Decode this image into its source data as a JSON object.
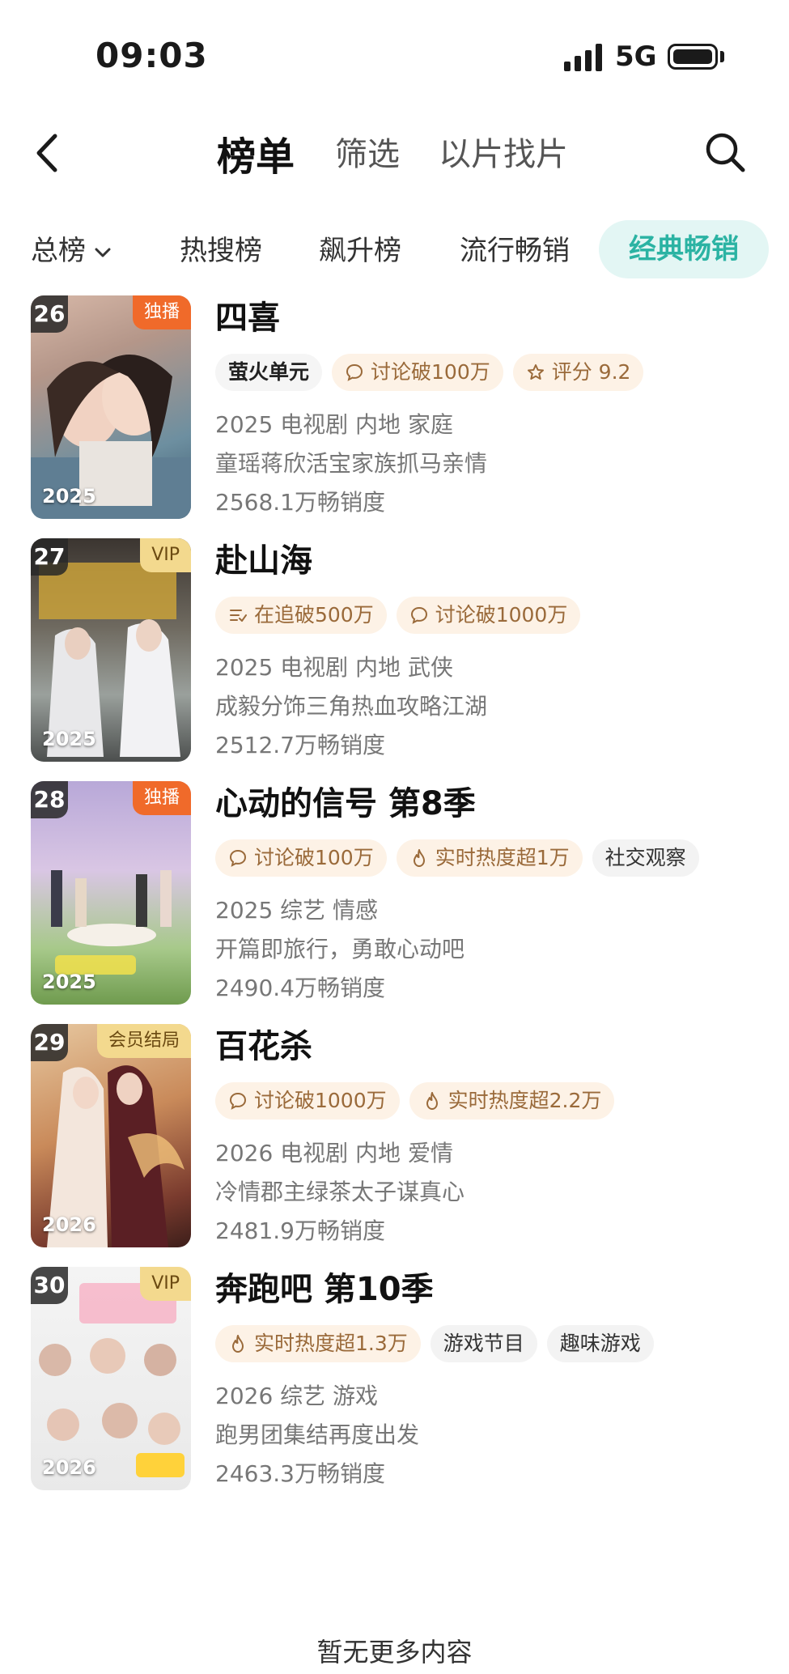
{
  "status_bar": {
    "time": "09:03",
    "network": "5G"
  },
  "header": {
    "tabs": [
      {
        "label": "榜单",
        "active": true
      },
      {
        "label": "筛选",
        "active": false
      },
      {
        "label": "以片找片",
        "active": false
      }
    ]
  },
  "filters": {
    "dropdown_label": "总榜",
    "items": [
      "热搜榜",
      "飙升榜",
      "流行畅销"
    ],
    "active": "经典畅销",
    "active_color": "#2bb3a3"
  },
  "list": [
    {
      "rank": "26",
      "badge": "独播",
      "badge_type": "exclusive",
      "poster_year": "2025",
      "title": "四喜",
      "tags": [
        {
          "icon": "brand-logo",
          "text": "萤火单元",
          "style": "brand"
        },
        {
          "icon": "comment-icon",
          "text": "讨论破100万",
          "style": "warm"
        },
        {
          "icon": "star-icon",
          "text": "评分 9.2",
          "style": "warm"
        }
      ],
      "meta": "2025 电视剧 内地 家庭",
      "desc": "童瑶蒋欣活宝家族抓马亲情",
      "sales": "2568.1万畅销度"
    },
    {
      "rank": "27",
      "badge": "VIP",
      "badge_type": "vip",
      "poster_year": "2025",
      "title": "赴山海",
      "tags": [
        {
          "icon": "list-icon",
          "text": "在追破500万",
          "style": "warm"
        },
        {
          "icon": "comment-icon",
          "text": "讨论破1000万",
          "style": "warm"
        }
      ],
      "meta": "2025 电视剧 内地 武侠",
      "desc": "成毅分饰三角热血攻略江湖",
      "sales": "2512.7万畅销度"
    },
    {
      "rank": "28",
      "badge": "独播",
      "badge_type": "exclusive",
      "poster_year": "2025",
      "title": "心动的信号 第8季",
      "tags": [
        {
          "icon": "comment-icon",
          "text": "讨论破100万",
          "style": "warm"
        },
        {
          "icon": "flame-icon",
          "text": "实时热度超1万",
          "style": "warm"
        },
        {
          "icon": "",
          "text": "社交观察",
          "style": "gray"
        }
      ],
      "meta": "2025 综艺 情感",
      "desc": "开篇即旅行，勇敢心动吧",
      "sales": "2490.4万畅销度"
    },
    {
      "rank": "29",
      "badge": "会员结局",
      "badge_type": "member",
      "poster_year": "2026",
      "title": "百花杀",
      "tags": [
        {
          "icon": "comment-icon",
          "text": "讨论破1000万",
          "style": "warm"
        },
        {
          "icon": "flame-icon",
          "text": "实时热度超2.2万",
          "style": "warm"
        }
      ],
      "meta": "2026 电视剧 内地 爱情",
      "desc": "冷情郡主绿茶太子谋真心",
      "sales": "2481.9万畅销度"
    },
    {
      "rank": "30",
      "badge": "VIP",
      "badge_type": "vip",
      "poster_year": "2026",
      "title": "奔跑吧 第10季",
      "tags": [
        {
          "icon": "flame-icon",
          "text": "实时热度超1.3万",
          "style": "warm"
        },
        {
          "icon": "",
          "text": "游戏节目",
          "style": "gray"
        },
        {
          "icon": "",
          "text": "趣味游戏",
          "style": "gray"
        }
      ],
      "meta": "2026 综艺 游戏",
      "desc": "跑男团集结再度出发",
      "sales": "2463.3万畅销度"
    }
  ],
  "footer": {
    "text": "暂无更多内容"
  }
}
